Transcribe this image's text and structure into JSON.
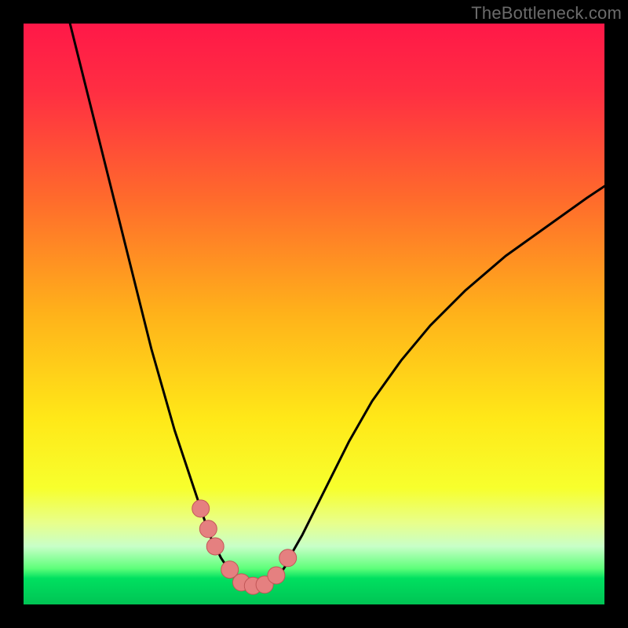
{
  "watermark": "TheBottleneck.com",
  "colors": {
    "frame": "#000000",
    "curve_stroke": "#000000",
    "marker_fill": "#e58080",
    "marker_stroke": "#c25757",
    "gradient_stops": [
      {
        "offset": 0.0,
        "color": "#ff1848"
      },
      {
        "offset": 0.12,
        "color": "#ff2f42"
      },
      {
        "offset": 0.3,
        "color": "#ff6a2c"
      },
      {
        "offset": 0.5,
        "color": "#ffb21a"
      },
      {
        "offset": 0.68,
        "color": "#ffe818"
      },
      {
        "offset": 0.8,
        "color": "#f7ff2d"
      },
      {
        "offset": 0.86,
        "color": "#e8ff8c"
      },
      {
        "offset": 0.9,
        "color": "#c8ffc8"
      },
      {
        "offset": 0.938,
        "color": "#5eff7a"
      },
      {
        "offset": 0.955,
        "color": "#00e060"
      },
      {
        "offset": 1.0,
        "color": "#00c454"
      }
    ]
  },
  "chart_data": {
    "type": "line",
    "title": "",
    "xlabel": "",
    "ylabel": "",
    "xlim": [
      0,
      100
    ],
    "ylim": [
      0,
      100
    ],
    "grid": false,
    "series": [
      {
        "name": "left-curve",
        "x": [
          8,
          10,
          12,
          14,
          16,
          18,
          20,
          22,
          24,
          26,
          28,
          29,
          30,
          31,
          32,
          33,
          34,
          35,
          36,
          37,
          38
        ],
        "y": [
          100,
          92,
          84,
          76,
          68,
          60,
          52,
          44,
          37,
          30,
          24,
          21,
          18,
          15,
          12,
          10,
          8,
          6.5,
          5,
          4,
          3.2
        ]
      },
      {
        "name": "right-curve",
        "x": [
          42,
          43,
          44,
          45,
          46,
          48,
          50,
          53,
          56,
          60,
          65,
          70,
          76,
          83,
          90,
          97,
          100
        ],
        "y": [
          3.2,
          4,
          5,
          6.5,
          8.5,
          12,
          16,
          22,
          28,
          35,
          42,
          48,
          54,
          60,
          65,
          70,
          72
        ]
      },
      {
        "name": "floor",
        "x": [
          38,
          42
        ],
        "y": [
          3.2,
          3.2
        ]
      }
    ],
    "markers": [
      {
        "x": 30.5,
        "y": 16.5
      },
      {
        "x": 31.8,
        "y": 13.0
      },
      {
        "x": 33.0,
        "y": 10.0
      },
      {
        "x": 35.5,
        "y": 6.0
      },
      {
        "x": 37.5,
        "y": 3.8
      },
      {
        "x": 39.5,
        "y": 3.2
      },
      {
        "x": 41.5,
        "y": 3.4
      },
      {
        "x": 43.5,
        "y": 5.0
      },
      {
        "x": 45.5,
        "y": 8.0
      }
    ]
  }
}
